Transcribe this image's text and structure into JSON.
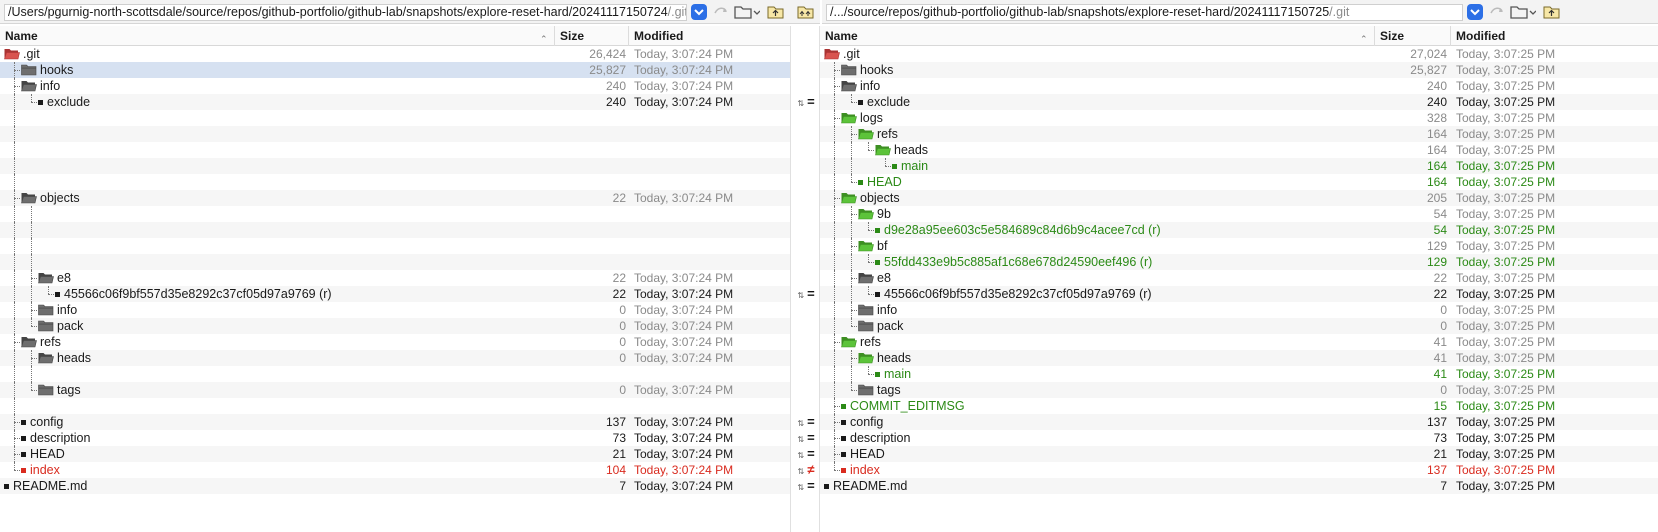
{
  "left": {
    "path_prefix": "/Users/pgurnig-north-scottsdale/source/repos/github-portfolio/github-lab/snapshots/explore-reset-hard/20241117150724",
    "path_suffix": "/.git",
    "headers": {
      "name": "Name",
      "size": "Size",
      "modified": "Modified"
    },
    "rows": [
      {
        "name": ".git",
        "size": "26,424",
        "mod": "Today, 3:07:24 PM",
        "kind": "folder-open",
        "level": 0,
        "status": "gray",
        "fc": "red"
      },
      {
        "name": "hooks",
        "size": "25,827",
        "mod": "Today, 3:07:24 PM",
        "kind": "folder",
        "level": 1,
        "status": "gray",
        "selected": true
      },
      {
        "name": "info",
        "size": "240",
        "mod": "Today, 3:07:24 PM",
        "kind": "folder-open",
        "level": 1,
        "status": "gray"
      },
      {
        "name": "exclude",
        "size": "240",
        "mod": "Today, 3:07:24 PM",
        "kind": "file",
        "level": 2,
        "status": "black"
      },
      {
        "name": "",
        "size": "",
        "mod": "",
        "kind": "blank",
        "level": 1
      },
      {
        "name": "",
        "size": "",
        "mod": "",
        "kind": "blank",
        "level": 1
      },
      {
        "name": "",
        "size": "",
        "mod": "",
        "kind": "blank",
        "level": 1
      },
      {
        "name": "",
        "size": "",
        "mod": "",
        "kind": "blank",
        "level": 1
      },
      {
        "name": "",
        "size": "",
        "mod": "",
        "kind": "blank",
        "level": 1
      },
      {
        "name": "objects",
        "size": "22",
        "mod": "Today, 3:07:24 PM",
        "kind": "folder-open",
        "level": 1,
        "status": "gray"
      },
      {
        "name": "",
        "size": "",
        "mod": "",
        "kind": "blank",
        "level": 2
      },
      {
        "name": "",
        "size": "",
        "mod": "",
        "kind": "blank",
        "level": 2
      },
      {
        "name": "",
        "size": "",
        "mod": "",
        "kind": "blank",
        "level": 2
      },
      {
        "name": "",
        "size": "",
        "mod": "",
        "kind": "blank",
        "level": 2
      },
      {
        "name": "e8",
        "size": "22",
        "mod": "Today, 3:07:24 PM",
        "kind": "folder-open",
        "level": 2,
        "status": "gray"
      },
      {
        "name": "45566c06f9bf557d35e8292c37cf05d97a9769 (r)",
        "size": "22",
        "mod": "Today, 3:07:24 PM",
        "kind": "file",
        "level": 3,
        "status": "black"
      },
      {
        "name": "info",
        "size": "0",
        "mod": "Today, 3:07:24 PM",
        "kind": "folder",
        "level": 2,
        "status": "gray"
      },
      {
        "name": "pack",
        "size": "0",
        "mod": "Today, 3:07:24 PM",
        "kind": "folder",
        "level": 2,
        "status": "gray"
      },
      {
        "name": "refs",
        "size": "0",
        "mod": "Today, 3:07:24 PM",
        "kind": "folder-open",
        "level": 1,
        "status": "gray"
      },
      {
        "name": "heads",
        "size": "0",
        "mod": "Today, 3:07:24 PM",
        "kind": "folder-open",
        "level": 2,
        "status": "gray"
      },
      {
        "name": "",
        "size": "",
        "mod": "",
        "kind": "blank",
        "level": 2
      },
      {
        "name": "tags",
        "size": "0",
        "mod": "Today, 3:07:24 PM",
        "kind": "folder",
        "level": 2,
        "status": "gray"
      },
      {
        "name": "",
        "size": "",
        "mod": "",
        "kind": "blank",
        "level": 1
      },
      {
        "name": "config",
        "size": "137",
        "mod": "Today, 3:07:24 PM",
        "kind": "file",
        "level": 1,
        "status": "black"
      },
      {
        "name": "description",
        "size": "73",
        "mod": "Today, 3:07:24 PM",
        "kind": "file",
        "level": 1,
        "status": "black"
      },
      {
        "name": "HEAD",
        "size": "21",
        "mod": "Today, 3:07:24 PM",
        "kind": "file",
        "level": 1,
        "status": "black"
      },
      {
        "name": "index",
        "size": "104",
        "mod": "Today, 3:07:24 PM",
        "kind": "file",
        "level": 1,
        "status": "red"
      },
      {
        "name": "README.md",
        "size": "7",
        "mod": "Today, 3:07:24 PM",
        "kind": "file",
        "level": 0,
        "status": "black"
      }
    ]
  },
  "right": {
    "path_prefix": "/.../source/repos/github-portfolio/github-lab/snapshots/explore-reset-hard/20241117150725",
    "path_suffix": "/.git",
    "headers": {
      "name": "Name",
      "size": "Size",
      "modified": "Modified"
    },
    "rows": [
      {
        "name": ".git",
        "size": "27,024",
        "mod": "Today, 3:07:25 PM",
        "kind": "folder-open",
        "level": 0,
        "status": "gray",
        "fc": "red"
      },
      {
        "name": "hooks",
        "size": "25,827",
        "mod": "Today, 3:07:25 PM",
        "kind": "folder",
        "level": 1,
        "status": "gray"
      },
      {
        "name": "info",
        "size": "240",
        "mod": "Today, 3:07:25 PM",
        "kind": "folder-open",
        "level": 1,
        "status": "gray"
      },
      {
        "name": "exclude",
        "size": "240",
        "mod": "Today, 3:07:25 PM",
        "kind": "file",
        "level": 2,
        "status": "black"
      },
      {
        "name": "logs",
        "size": "328",
        "mod": "Today, 3:07:25 PM",
        "kind": "folder-open",
        "level": 1,
        "status": "gray",
        "fc": "green"
      },
      {
        "name": "refs",
        "size": "164",
        "mod": "Today, 3:07:25 PM",
        "kind": "folder-open",
        "level": 2,
        "status": "gray",
        "fc": "green"
      },
      {
        "name": "heads",
        "size": "164",
        "mod": "Today, 3:07:25 PM",
        "kind": "folder-open",
        "level": 3,
        "status": "gray",
        "fc": "green"
      },
      {
        "name": "main",
        "size": "164",
        "mod": "Today, 3:07:25 PM",
        "kind": "file",
        "level": 4,
        "status": "green"
      },
      {
        "name": "HEAD",
        "size": "164",
        "mod": "Today, 3:07:25 PM",
        "kind": "file",
        "level": 2,
        "status": "green"
      },
      {
        "name": "objects",
        "size": "205",
        "mod": "Today, 3:07:25 PM",
        "kind": "folder-open",
        "level": 1,
        "status": "gray",
        "fc": "green"
      },
      {
        "name": "9b",
        "size": "54",
        "mod": "Today, 3:07:25 PM",
        "kind": "folder-open",
        "level": 2,
        "status": "gray",
        "fc": "green"
      },
      {
        "name": "d9e28a95ee603c5e584689c84d6b9c4acee7cd (r)",
        "size": "54",
        "mod": "Today, 3:07:25 PM",
        "kind": "file",
        "level": 3,
        "status": "green"
      },
      {
        "name": "bf",
        "size": "129",
        "mod": "Today, 3:07:25 PM",
        "kind": "folder-open",
        "level": 2,
        "status": "gray",
        "fc": "green"
      },
      {
        "name": "55fdd433e9b5c885af1c68e678d24590eef496 (r)",
        "size": "129",
        "mod": "Today, 3:07:25 PM",
        "kind": "file",
        "level": 3,
        "status": "green"
      },
      {
        "name": "e8",
        "size": "22",
        "mod": "Today, 3:07:25 PM",
        "kind": "folder-open",
        "level": 2,
        "status": "gray"
      },
      {
        "name": "45566c06f9bf557d35e8292c37cf05d97a9769 (r)",
        "size": "22",
        "mod": "Today, 3:07:25 PM",
        "kind": "file",
        "level": 3,
        "status": "black"
      },
      {
        "name": "info",
        "size": "0",
        "mod": "Today, 3:07:25 PM",
        "kind": "folder",
        "level": 2,
        "status": "gray"
      },
      {
        "name": "pack",
        "size": "0",
        "mod": "Today, 3:07:25 PM",
        "kind": "folder",
        "level": 2,
        "status": "gray"
      },
      {
        "name": "refs",
        "size": "41",
        "mod": "Today, 3:07:25 PM",
        "kind": "folder-open",
        "level": 1,
        "status": "gray",
        "fc": "green"
      },
      {
        "name": "heads",
        "size": "41",
        "mod": "Today, 3:07:25 PM",
        "kind": "folder-open",
        "level": 2,
        "status": "gray",
        "fc": "green"
      },
      {
        "name": "main",
        "size": "41",
        "mod": "Today, 3:07:25 PM",
        "kind": "file",
        "level": 3,
        "status": "green"
      },
      {
        "name": "tags",
        "size": "0",
        "mod": "Today, 3:07:25 PM",
        "kind": "folder",
        "level": 2,
        "status": "gray"
      },
      {
        "name": "COMMIT_EDITMSG",
        "size": "15",
        "mod": "Today, 3:07:25 PM",
        "kind": "file",
        "level": 1,
        "status": "green"
      },
      {
        "name": "config",
        "size": "137",
        "mod": "Today, 3:07:25 PM",
        "kind": "file",
        "level": 1,
        "status": "black"
      },
      {
        "name": "description",
        "size": "73",
        "mod": "Today, 3:07:25 PM",
        "kind": "file",
        "level": 1,
        "status": "black"
      },
      {
        "name": "HEAD",
        "size": "21",
        "mod": "Today, 3:07:25 PM",
        "kind": "file",
        "level": 1,
        "status": "black"
      },
      {
        "name": "index",
        "size": "137",
        "mod": "Today, 3:07:25 PM",
        "kind": "file",
        "level": 1,
        "status": "red"
      },
      {
        "name": "README.md",
        "size": "7",
        "mod": "Today, 3:07:25 PM",
        "kind": "file",
        "level": 0,
        "status": "black"
      }
    ]
  },
  "gutter": [
    {
      "row": 3,
      "mark": "="
    },
    {
      "row": 15,
      "mark": "="
    },
    {
      "row": 23,
      "mark": "="
    },
    {
      "row": 24,
      "mark": "="
    },
    {
      "row": 25,
      "mark": "="
    },
    {
      "row": 26,
      "mark": "≠"
    },
    {
      "row": 27,
      "mark": "="
    }
  ],
  "colors": {
    "gray": "#8a8a8a",
    "black": "#1a1a1a",
    "green": "#2b8a16",
    "red": "#d92b1f",
    "folder_gray": "#6e6e6e",
    "folder_green": "#5cc33a",
    "folder_red": "#d9534f",
    "accent": "#2c6fe6"
  },
  "icons": [
    "folder-icon",
    "folder-open-icon",
    "file-bullet-icon",
    "chevron-down-icon",
    "sort-up-icon",
    "swap-icon",
    "up-folder-icon",
    "browse-folder-icon"
  ]
}
